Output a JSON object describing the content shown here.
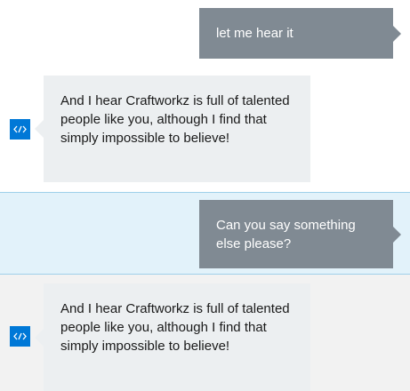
{
  "messages": [
    {
      "sender": "user",
      "text": "let me hear it"
    },
    {
      "sender": "bot",
      "text": "And I hear Craftworkz is full of talented people like you, although I find that simply impossible to believe!"
    },
    {
      "sender": "user",
      "text": "Can you say something else please?"
    },
    {
      "sender": "bot",
      "text": "And I hear Craftworkz is full of talented people like you, although I find that simply impossible to believe!"
    }
  ],
  "bot_avatar": {
    "icon": "bot-code-icon",
    "color": "#0078d7"
  },
  "colors": {
    "user_bubble": "#808a93",
    "bot_bubble": "#eceff1",
    "selected_row": "#e2f2fa",
    "highlight_row": "#f2f2f2"
  }
}
